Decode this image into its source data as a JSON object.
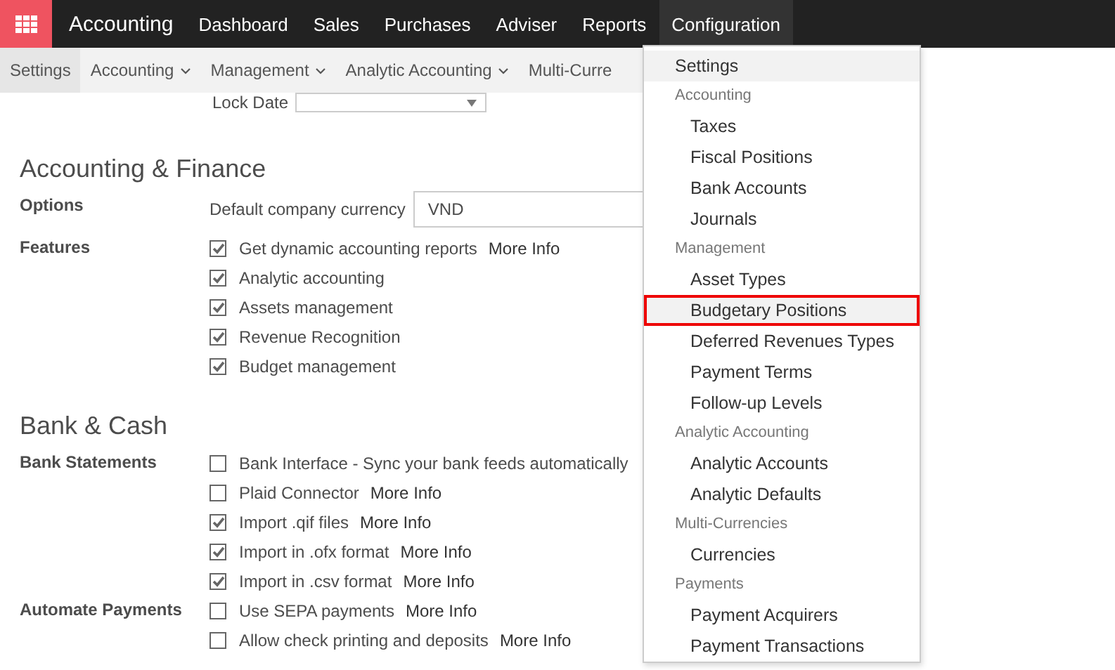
{
  "topbar": {
    "app_name": "Accounting",
    "menus": [
      {
        "label": "Dashboard",
        "selected": false
      },
      {
        "label": "Sales",
        "selected": false
      },
      {
        "label": "Purchases",
        "selected": false
      },
      {
        "label": "Adviser",
        "selected": false
      },
      {
        "label": "Reports",
        "selected": false
      },
      {
        "label": "Configuration",
        "selected": true
      }
    ]
  },
  "subbar": [
    {
      "label": "Settings",
      "selected": true,
      "dropdown": false
    },
    {
      "label": "Accounting",
      "selected": false,
      "dropdown": true
    },
    {
      "label": "Management",
      "selected": false,
      "dropdown": true
    },
    {
      "label": "Analytic Accounting",
      "selected": false,
      "dropdown": true
    },
    {
      "label": "Multi-Curre",
      "selected": false,
      "dropdown": false
    }
  ],
  "lock_date": {
    "label": "Lock Date"
  },
  "sections": [
    {
      "title": "Accounting & Finance",
      "groups": [
        {
          "label": "Options",
          "rows": [
            {
              "kind": "field",
              "label": "Default company currency",
              "value": "VND"
            }
          ]
        },
        {
          "label": "Features",
          "rows": [
            {
              "kind": "checkbox",
              "label": "Get dynamic accounting reports",
              "checked": true,
              "link": "More Info"
            },
            {
              "kind": "checkbox",
              "label": "Analytic accounting",
              "checked": true
            },
            {
              "kind": "checkbox",
              "label": "Assets management",
              "checked": true
            },
            {
              "kind": "checkbox",
              "label": "Revenue Recognition",
              "checked": true
            },
            {
              "kind": "checkbox",
              "label": "Budget management",
              "checked": true
            }
          ]
        }
      ]
    },
    {
      "title": "Bank & Cash",
      "groups": [
        {
          "label": "Bank Statements",
          "rows": [
            {
              "kind": "checkbox",
              "label": "Bank Interface - Sync your bank feeds automatically",
              "checked": false
            },
            {
              "kind": "checkbox",
              "label": "Plaid Connector",
              "checked": false,
              "link": "More Info"
            },
            {
              "kind": "checkbox",
              "label": "Import .qif files",
              "checked": true,
              "link": "More Info"
            },
            {
              "kind": "checkbox",
              "label": "Import in .ofx format",
              "checked": true,
              "link": "More Info"
            },
            {
              "kind": "checkbox",
              "label": "Import in .csv format",
              "checked": true,
              "link": "More Info"
            }
          ]
        },
        {
          "label": "Automate Payments",
          "rows": [
            {
              "kind": "checkbox",
              "label": "Use SEPA payments",
              "checked": false,
              "link": "More Info"
            },
            {
              "kind": "checkbox",
              "label": "Allow check printing and deposits",
              "checked": false,
              "link": "More Info"
            }
          ]
        }
      ]
    }
  ],
  "dropdown": [
    {
      "kind": "item",
      "label": "Settings",
      "highlighted": true,
      "outlined": false
    },
    {
      "kind": "header",
      "label": "Accounting"
    },
    {
      "kind": "subitem",
      "label": "Taxes",
      "highlighted": false,
      "outlined": false
    },
    {
      "kind": "subitem",
      "label": "Fiscal Positions",
      "highlighted": false,
      "outlined": false
    },
    {
      "kind": "subitem",
      "label": "Bank Accounts",
      "highlighted": false,
      "outlined": false
    },
    {
      "kind": "subitem",
      "label": "Journals",
      "highlighted": false,
      "outlined": false
    },
    {
      "kind": "header",
      "label": "Management"
    },
    {
      "kind": "subitem",
      "label": "Asset Types",
      "highlighted": false,
      "outlined": false
    },
    {
      "kind": "subitem",
      "label": "Budgetary Positions",
      "highlighted": true,
      "outlined": true
    },
    {
      "kind": "subitem",
      "label": "Deferred Revenues Types",
      "highlighted": false,
      "outlined": false
    },
    {
      "kind": "subitem",
      "label": "Payment Terms",
      "highlighted": false,
      "outlined": false
    },
    {
      "kind": "subitem",
      "label": "Follow-up Levels",
      "highlighted": false,
      "outlined": false
    },
    {
      "kind": "header",
      "label": "Analytic Accounting"
    },
    {
      "kind": "subitem",
      "label": "Analytic Accounts",
      "highlighted": false,
      "outlined": false
    },
    {
      "kind": "subitem",
      "label": "Analytic Defaults",
      "highlighted": false,
      "outlined": false
    },
    {
      "kind": "header",
      "label": "Multi-Currencies"
    },
    {
      "kind": "subitem",
      "label": "Currencies",
      "highlighted": false,
      "outlined": false
    },
    {
      "kind": "header",
      "label": "Payments"
    },
    {
      "kind": "subitem",
      "label": "Payment Acquirers",
      "highlighted": false,
      "outlined": false
    },
    {
      "kind": "subitem",
      "label": "Payment Transactions",
      "highlighted": false,
      "outlined": false
    }
  ]
}
